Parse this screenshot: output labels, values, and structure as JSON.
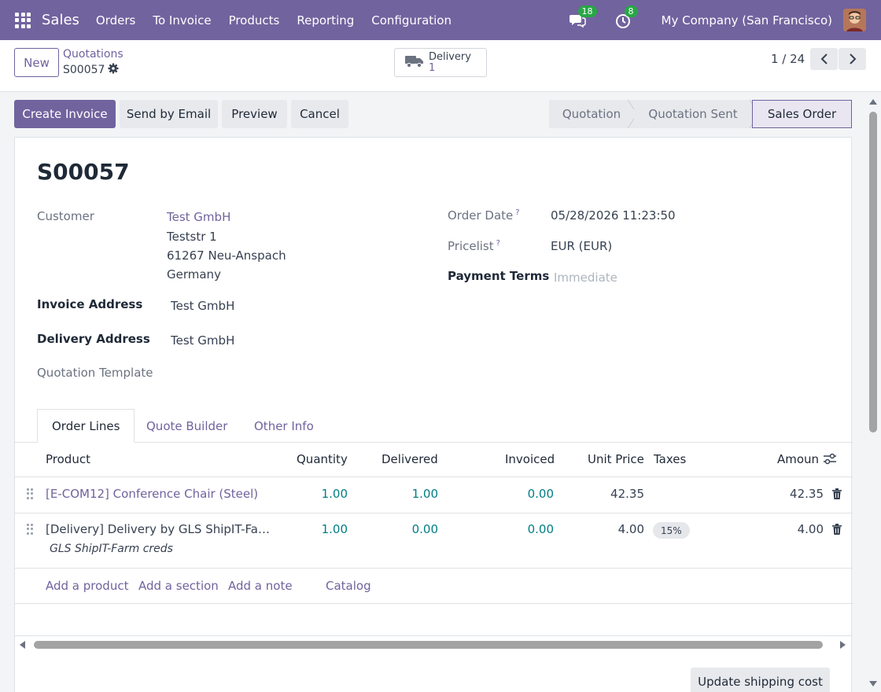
{
  "topbar": {
    "app_name": "Sales",
    "menu": [
      "Orders",
      "To Invoice",
      "Products",
      "Reporting",
      "Configuration"
    ],
    "messages_count": "18",
    "activities_count": "8",
    "company": "My Company (San Francisco)"
  },
  "control": {
    "new_label": "New",
    "breadcrumb_parent": "Quotations",
    "breadcrumb_current": "S00057",
    "smart_button_label": "Delivery",
    "smart_button_count": "1",
    "pager": "1 / 24"
  },
  "actions": {
    "create_invoice": "Create Invoice",
    "send_email": "Send by Email",
    "preview": "Preview",
    "cancel": "Cancel"
  },
  "status": {
    "stages": [
      "Quotation",
      "Quotation Sent",
      "Sales Order"
    ],
    "active": "Sales Order"
  },
  "form": {
    "title": "S00057",
    "customer_label": "Customer",
    "customer_name": "Test GmbH",
    "customer_street": "Teststr 1",
    "customer_city": "61267 Neu-Anspach",
    "customer_country": "Germany",
    "invoice_address_label": "Invoice Address",
    "invoice_address": "Test GmbH",
    "delivery_address_label": "Delivery Address",
    "delivery_address": "Test GmbH",
    "quotation_template_label": "Quotation Template",
    "order_date_label": "Order Date",
    "order_date": "05/28/2026 11:23:50",
    "pricelist_label": "Pricelist",
    "pricelist": "EUR (EUR)",
    "payment_terms_label": "Payment Terms",
    "payment_terms_placeholder": "Immediate",
    "help_mark": "?"
  },
  "tabs": [
    "Order Lines",
    "Quote Builder",
    "Other Info"
  ],
  "table": {
    "headers": {
      "product": "Product",
      "quantity": "Quantity",
      "delivered": "Delivered",
      "invoiced": "Invoiced",
      "unit_price": "Unit Price",
      "taxes": "Taxes",
      "amount": "Amoun"
    },
    "rows": [
      {
        "product": "[E-COM12] Conference Chair (Steel)",
        "quantity": "1.00",
        "delivered": "1.00",
        "invoiced": "0.00",
        "unit_price": "42.35",
        "tax": "",
        "amount": "42.35",
        "note": ""
      },
      {
        "product": "[Delivery] Delivery by GLS ShipIT-Fa…",
        "quantity": "1.00",
        "delivered": "0.00",
        "invoiced": "0.00",
        "unit_price": "4.00",
        "tax": "15%",
        "amount": "4.00",
        "note": "GLS ShipIT-Farm creds"
      }
    ],
    "add_links": [
      "Add a product",
      "Add a section",
      "Add a note",
      "Catalog"
    ]
  },
  "footer": {
    "update_shipping": "Update shipping cost"
  }
}
